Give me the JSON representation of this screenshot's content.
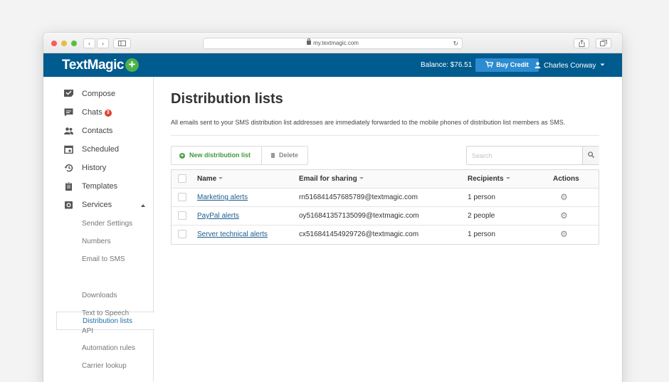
{
  "browser": {
    "url": "my.textmagic.com",
    "back_label": "‹",
    "forward_label": "›"
  },
  "header": {
    "logo": "TextMagic",
    "logo_plus": "+",
    "balance": "Balance: $76.51",
    "buy_credit": "Buy Credit",
    "user_name": "Charles Conway"
  },
  "sidebar": {
    "items": [
      {
        "label": "Compose",
        "icon": "compose-icon"
      },
      {
        "label": "Chats",
        "icon": "chat-icon",
        "badge": "3"
      },
      {
        "label": "Contacts",
        "icon": "contacts-icon"
      },
      {
        "label": "Scheduled",
        "icon": "calendar-icon"
      },
      {
        "label": "History",
        "icon": "history-icon"
      },
      {
        "label": "Templates",
        "icon": "templates-icon"
      },
      {
        "label": "Services",
        "icon": "services-icon"
      }
    ],
    "sub_items": [
      "Sender Settings",
      "Numbers",
      "Email to SMS",
      "Distribution lists",
      "Downloads",
      "Text to Speech",
      "API",
      "Automation rules",
      "Carrier lookup"
    ],
    "active_sub": "Distribution lists"
  },
  "main": {
    "title": "Distribution lists",
    "description": "All emails sent to your SMS distribution list addresses are immediately forwarded to the mobile phones of distribution list members as SMS.",
    "new_button": "New distribution list",
    "delete_button": "Delete",
    "search_placeholder": "Search",
    "columns": [
      "Name",
      "Email for sharing",
      "Recipients",
      "Actions"
    ],
    "rows": [
      {
        "name": "Marketing alerts",
        "email": "rn516841457685789@textmagic.com",
        "recipients": "1 person"
      },
      {
        "name": "PayPal alerts",
        "email": "oy516841357135099@textmagic.com",
        "recipients": "2 people"
      },
      {
        "name": "Server technical alerts",
        "email": "cx516841454929726@textmagic.com",
        "recipients": "1 person"
      }
    ]
  },
  "colors": {
    "header_bg": "#005b8f",
    "buy_button": "#2d8bd0",
    "accent_green": "#4db04a",
    "link": "#1b5d8e"
  }
}
